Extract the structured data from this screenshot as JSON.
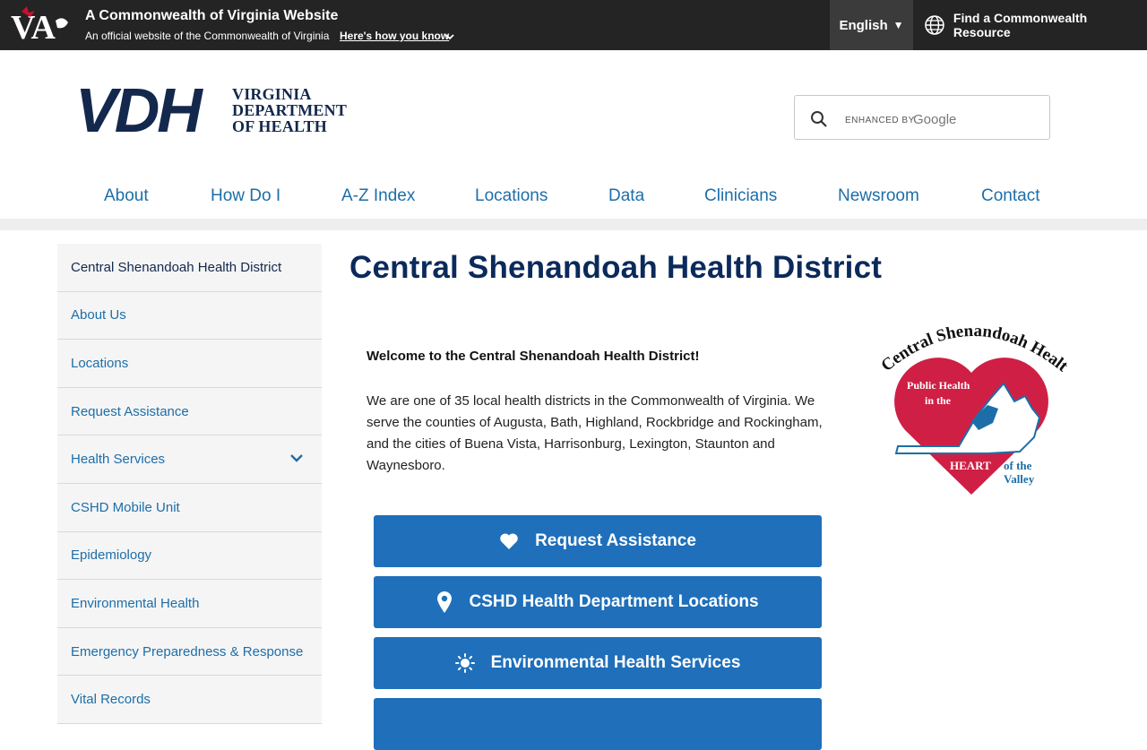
{
  "banner": {
    "title": "A Commonwealth of Virginia Website",
    "subtitle": "An official website of the Commonwealth of Virginia",
    "how_link": "Here's how you know",
    "language": "English",
    "resource": "Find a Commonwealth Resource",
    "logo_text": "VA"
  },
  "header": {
    "logo_big": "VDH",
    "logo_small": [
      "VIRGINIA",
      "DEPARTMENT",
      "OF HEALTH"
    ],
    "search_enhanced": "ENHANCED BY",
    "search_google": "Google"
  },
  "nav": [
    "About",
    "How Do I",
    "A-Z Index",
    "Locations",
    "Data",
    "Clinicians",
    "Newsroom",
    "Contact"
  ],
  "sidebar": [
    "Central Shenandoah Health District",
    "About Us",
    "Locations",
    "Request Assistance",
    "Health Services",
    "CSHD Mobile Unit",
    "Epidemiology",
    "Environmental Health",
    "Emergency Preparedness & Response",
    "Vital Records"
  ],
  "content": {
    "title": "Central Shenandoah Health District",
    "welcome": "Welcome to the Central Shenandoah Health District!",
    "intro": "We are one of 35 local health districts in the Commonwealth of Virginia. We serve the counties of Augusta, Bath, Highland, Rockbridge and Rockingham, and the cities of Buena Vista, Harrisonburg, Lexington, Staunton and Waynesboro.",
    "buttons": [
      {
        "label": "Request Assistance",
        "icon": "heart-icon"
      },
      {
        "label": "CSHD Health Department Locations",
        "icon": "map-pin-icon"
      },
      {
        "label": "Environmental Health Services",
        "icon": "sun-icon"
      }
    ]
  },
  "district_logo": {
    "arc": "Central Shenandoah Health District",
    "line1": "Public Health",
    "line2": "in the",
    "heart": "HEART",
    "of_the": "of the",
    "valley": "Valley"
  },
  "colors": {
    "banner_bg": "#242424",
    "nav_link": "#1d6ea8",
    "title": "#0b2a5b",
    "cta": "#1f6fba",
    "logo_navy": "#13284c",
    "heart_red": "#cf1f45"
  }
}
